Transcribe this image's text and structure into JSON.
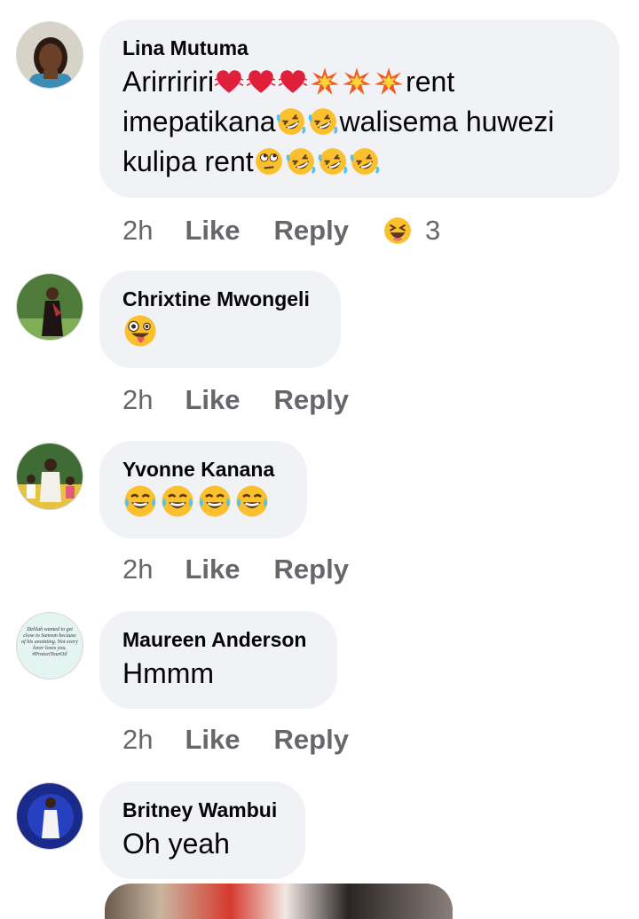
{
  "comments": [
    {
      "name": "Lina Mutuma",
      "lines": [
        {
          "segments": [
            {
              "text": "Arirririri"
            },
            {
              "emoji": "heart-pulse-icon"
            },
            {
              "emoji": "heart-pulse-icon"
            },
            {
              "emoji": "heart-pulse-icon"
            },
            {
              "emoji": "collision-icon"
            },
            {
              "emoji": "collision-icon"
            },
            {
              "emoji": "collision-icon"
            },
            {
              "text": "rent"
            }
          ]
        },
        {
          "segments": [
            {
              "text": "imepatikana"
            },
            {
              "emoji": "rofl-icon"
            },
            {
              "emoji": "rofl-icon"
            },
            {
              "text": "walisema huwezi"
            }
          ]
        },
        {
          "segments": [
            {
              "text": "kulipa rent"
            },
            {
              "emoji": "eye-roll-icon"
            },
            {
              "emoji": "rofl-icon"
            },
            {
              "emoji": "rofl-icon"
            },
            {
              "emoji": "rofl-icon"
            }
          ]
        }
      ],
      "time": "2h",
      "like": "Like",
      "reply": "Reply",
      "reaction": {
        "icon": "laughing-reaction-icon",
        "count": "3"
      }
    },
    {
      "name": "Chrixtine Mwongeli",
      "lines": [
        {
          "segments": [
            {
              "emoji": "zany-face-icon"
            }
          ]
        }
      ],
      "time": "2h",
      "like": "Like",
      "reply": "Reply"
    },
    {
      "name": "Yvonne Kanana",
      "lines": [
        {
          "segments": [
            {
              "emoji": "tears-of-joy-icon"
            },
            {
              "emoji": "tears-of-joy-icon"
            },
            {
              "emoji": "tears-of-joy-icon"
            },
            {
              "emoji": "tears-of-joy-icon"
            }
          ]
        }
      ],
      "time": "2h",
      "like": "Like",
      "reply": "Reply"
    },
    {
      "name": "Maureen Anderson",
      "avatar_text": "Delilah wanted to get close to Samson because of his anointing. Not every lover loves you. #ProtectYourOil",
      "lines": [
        {
          "segments": [
            {
              "text": "Hmmm"
            }
          ]
        }
      ],
      "time": "2h",
      "like": "Like",
      "reply": "Reply"
    },
    {
      "name": "Britney Wambui",
      "lines": [
        {
          "segments": [
            {
              "text": "Oh yeah"
            }
          ]
        }
      ]
    }
  ]
}
